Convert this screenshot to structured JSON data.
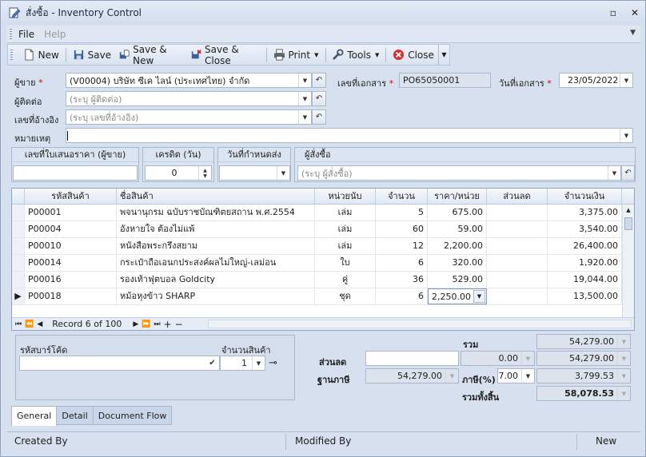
{
  "window": {
    "title": "สั่งซื้อ - Inventory Control",
    "restore_glyph": "▫",
    "close_glyph": "✕"
  },
  "menu": {
    "file": "File",
    "help": "Help"
  },
  "toolbar": {
    "new": "New",
    "save": "Save",
    "save_new": "Save & New",
    "save_close": "Save & Close",
    "print": "Print",
    "tools": "Tools",
    "close": "Close"
  },
  "header": {
    "vendor_label": "ผู้ขาย",
    "vendor_value": "(V00004) บริษัท ซีเค ไลน์ (ประเทศไทย) จำกัด",
    "contact_label": "ผู้ติดต่อ",
    "contact_placeholder": "(ระบุ ผู้ติดต่อ)",
    "ref_label": "เลขที่อ้างอิง",
    "ref_placeholder": "(ระบุ เลขที่อ้างอิง)",
    "remark_label": "หมายเหตุ",
    "remark_value": "",
    "docno_label": "เลขที่เอกสาร",
    "docno_value": "PO65050001",
    "docdate_label": "วันที่เอกสาร",
    "docdate_value": "23/05/2022",
    "req_mark": "*"
  },
  "groups": {
    "quote_label": "เลขที่ใบเสนอราคา (ผู้ขาย)",
    "quote_value": "",
    "credit_label": "เครดิต (วัน)",
    "credit_value": "0",
    "delivery_label": "วันที่กำหนดส่ง",
    "delivery_value": "",
    "buyer_label": "ผู้สั่งซื้อ",
    "buyer_placeholder": "(ระบุ ผู้สั่งซื้อ)"
  },
  "grid": {
    "columns": [
      "รหัสสินค้า",
      "ชื่อสินค้า",
      "หน่วยนับ",
      "จำนวน",
      "ราคา/หน่วย",
      "ส่วนลด",
      "จำนวนเงิน"
    ],
    "rows": [
      {
        "code": "P00001",
        "name": "พจนานุกรม ฉบับราชบัณฑิตยสถาน พ.ศ.2554",
        "unit": "เล่ม",
        "qty": "5",
        "price": "675.00",
        "disc": "",
        "amount": "3,375.00"
      },
      {
        "code": "P00004",
        "name": "อังหายใจ ต้องไม่แพ้",
        "unit": "เล่ม",
        "qty": "60",
        "price": "59.00",
        "disc": "",
        "amount": "3,540.00"
      },
      {
        "code": "P00010",
        "name": "หนังสือพระกรึงสยาม",
        "unit": "เล่ม",
        "qty": "12",
        "price": "2,200.00",
        "disc": "",
        "amount": "26,400.00"
      },
      {
        "code": "P00014",
        "name": "กระเป๋าถือเอนกประสงค์ผลไม่ใหญ่-เลม่อน",
        "unit": "ใบ",
        "qty": "6",
        "price": "320.00",
        "disc": "",
        "amount": "1,920.00"
      },
      {
        "code": "P00016",
        "name": "รองเท้าฟุตบอล Goldcity",
        "unit": "คู่",
        "qty": "36",
        "price": "529.00",
        "disc": "",
        "amount": "19,044.00"
      },
      {
        "code": "P00018",
        "name": "หม้อหุงข้าว SHARP",
        "unit": "ชุด",
        "qty": "6",
        "price": "2,250.00",
        "disc": "",
        "amount": "13,500.00"
      }
    ],
    "current_row_marker": "▶",
    "record_text": "Record 6 of 100"
  },
  "barcode": {
    "barcode_label": "รหัสบาร์โค้ด",
    "qty_label": "จำนวนสินค้า",
    "qty_value": "1"
  },
  "totals": {
    "sum_label": "รวม",
    "sum_value": "54,279.00",
    "discount_label": "ส่วนลด",
    "discount_input": "",
    "discount_amount": "0.00",
    "after_discount": "54,279.00",
    "taxbase_label": "ฐานภาษี",
    "taxbase_value": "54,279.00",
    "vat_label": "ภาษี(%)",
    "vat_rate": "7.00",
    "vat_value": "3,799.53",
    "grand_label": "รวมทั้งสิ้น",
    "grand_value": "58,078.53"
  },
  "tabs": [
    "General",
    "Detail",
    "Document Flow"
  ],
  "status": {
    "created_by": "Created By",
    "modified_by": "Modified By",
    "state": "New"
  }
}
